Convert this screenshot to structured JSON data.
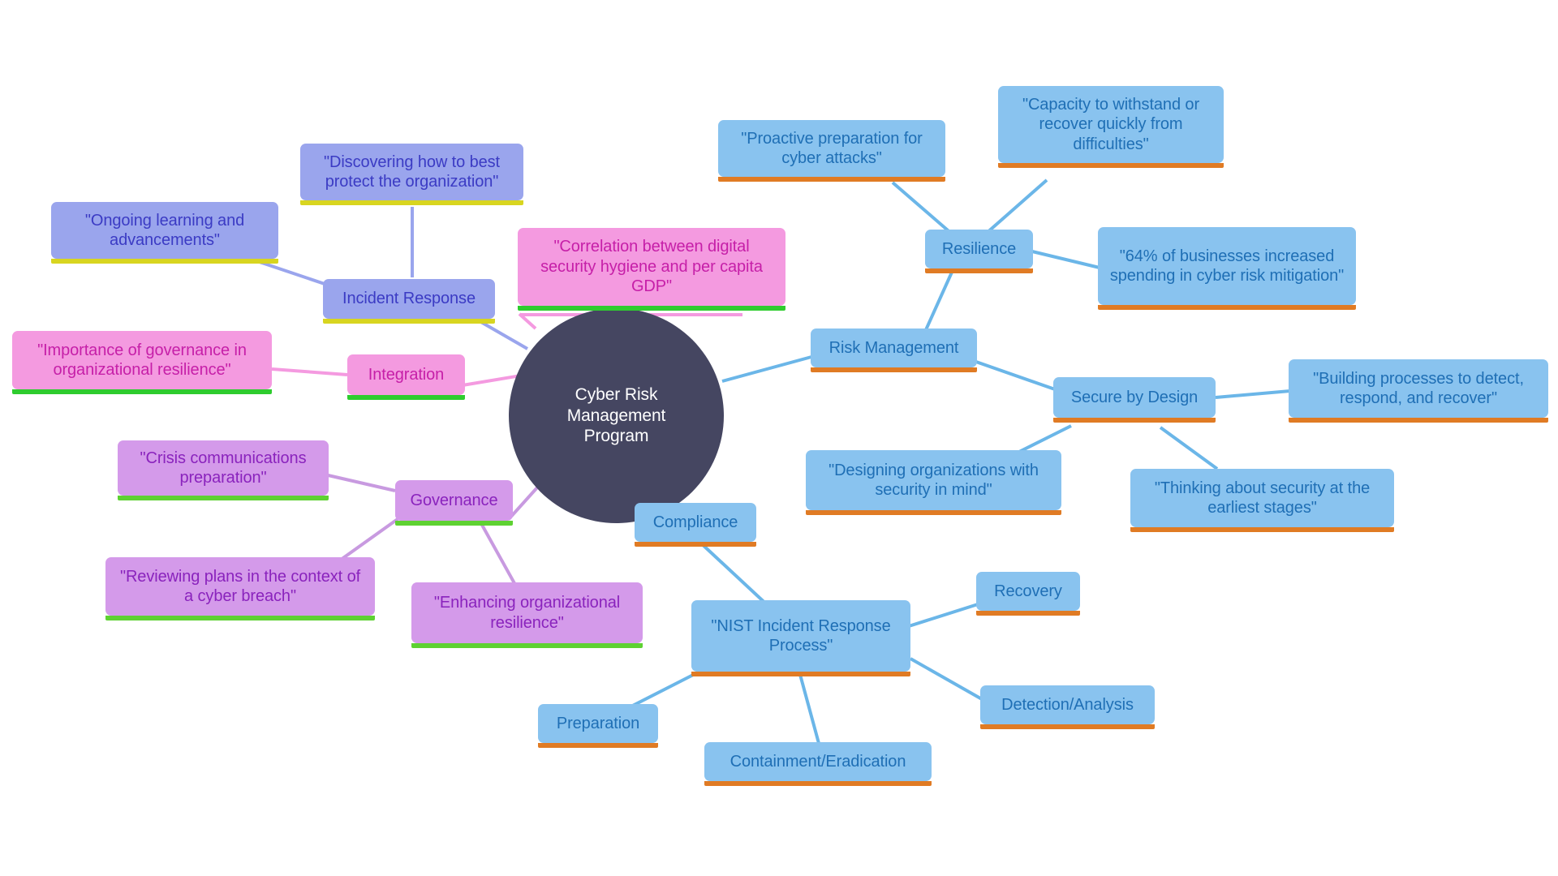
{
  "diagram": {
    "type": "mind-map",
    "title": "Cyber Risk Management Program",
    "background": "#ffffff",
    "root": {
      "id": "root",
      "label": "Cyber Risk Management Program",
      "shape": "circle",
      "fill": "#454661",
      "text_color": "#ffffff"
    },
    "branch_styles": {
      "blue": {
        "fill": "#89c3ef",
        "text_color": "#1f6fb5",
        "accent": "#e07b24",
        "edge": "#6bb6e8"
      },
      "periwinkle": {
        "fill": "#9aa5ed",
        "text_color": "#3b3bc4",
        "accent": "#d8d520",
        "edge": "#9aa5ed"
      },
      "pink": {
        "fill": "#f49ae0",
        "text_color": "#c61fa8",
        "accent": "#2ecc2e",
        "edge": "#f49ae0"
      },
      "orchid": {
        "fill": "#d49aea",
        "text_color": "#8a23bd",
        "accent": "#5ed132",
        "edge": "#c89ae0"
      }
    },
    "nodes": [
      {
        "id": "risk_management",
        "label": "Risk Management",
        "branch": "blue"
      },
      {
        "id": "resilience",
        "label": "Resilience",
        "branch": "blue"
      },
      {
        "id": "proactive_prep",
        "label": "\"Proactive preparation for cyber attacks\"",
        "branch": "blue"
      },
      {
        "id": "capacity_withstand",
        "label": "\"Capacity to withstand or recover quickly from difficulties\"",
        "branch": "blue"
      },
      {
        "id": "spending_stat",
        "label": "\"64% of businesses increased spending in cyber risk mitigation\"",
        "branch": "blue"
      },
      {
        "id": "secure_by_design",
        "label": "Secure by Design",
        "branch": "blue"
      },
      {
        "id": "building_processes",
        "label": "\"Building processes to detect, respond, and recover\"",
        "branch": "blue"
      },
      {
        "id": "designing_orgs",
        "label": "\"Designing organizations with security in mind\"",
        "branch": "blue"
      },
      {
        "id": "thinking_earliest",
        "label": "\"Thinking about security at the earliest stages\"",
        "branch": "blue"
      },
      {
        "id": "compliance",
        "label": "Compliance",
        "branch": "blue"
      },
      {
        "id": "nist_process",
        "label": "\"NIST Incident Response Process\"",
        "branch": "blue"
      },
      {
        "id": "recovery",
        "label": "Recovery",
        "branch": "blue"
      },
      {
        "id": "detection_analysis",
        "label": "Detection/Analysis",
        "branch": "blue"
      },
      {
        "id": "preparation",
        "label": "Preparation",
        "branch": "blue"
      },
      {
        "id": "containment",
        "label": "Containment/Eradication",
        "branch": "blue"
      },
      {
        "id": "incident_response",
        "label": "Incident Response",
        "branch": "periwinkle"
      },
      {
        "id": "ongoing_learning",
        "label": "\"Ongoing learning and advancements\"",
        "branch": "periwinkle"
      },
      {
        "id": "discovering_protect",
        "label": "\"Discovering how to best protect the organization\"",
        "branch": "periwinkle"
      },
      {
        "id": "integration",
        "label": "Integration",
        "branch": "pink"
      },
      {
        "id": "correlation_gdp",
        "label": "\"Correlation between digital security hygiene and per capita GDP\"",
        "branch": "pink"
      },
      {
        "id": "governance_importance",
        "label": "\"Importance of governance in organizational resilience\"",
        "branch": "pink"
      },
      {
        "id": "governance",
        "label": "Governance",
        "branch": "orchid"
      },
      {
        "id": "crisis_comms",
        "label": "\"Crisis communications preparation\"",
        "branch": "orchid"
      },
      {
        "id": "reviewing_plans",
        "label": "\"Reviewing plans in the context of a cyber breach\"",
        "branch": "orchid"
      },
      {
        "id": "enhancing_resilience",
        "label": "\"Enhancing organizational resilience\"",
        "branch": "orchid"
      }
    ],
    "edges": [
      {
        "from": "root",
        "to": "risk_management",
        "color": "#6bb6e8"
      },
      {
        "from": "root",
        "to": "compliance",
        "color": "#6bb6e8"
      },
      {
        "from": "root",
        "to": "incident_response",
        "color": "#9aa5ed"
      },
      {
        "from": "root",
        "to": "correlation_gdp",
        "color": "#f49ae0"
      },
      {
        "from": "root",
        "to": "integration",
        "color": "#f49ae0"
      },
      {
        "from": "root",
        "to": "governance",
        "color": "#c89ae0"
      },
      {
        "from": "risk_management",
        "to": "resilience",
        "color": "#6bb6e8"
      },
      {
        "from": "risk_management",
        "to": "secure_by_design",
        "color": "#6bb6e8"
      },
      {
        "from": "resilience",
        "to": "proactive_prep",
        "color": "#6bb6e8"
      },
      {
        "from": "resilience",
        "to": "capacity_withstand",
        "color": "#6bb6e8"
      },
      {
        "from": "resilience",
        "to": "spending_stat",
        "color": "#6bb6e8"
      },
      {
        "from": "secure_by_design",
        "to": "building_processes",
        "color": "#6bb6e8"
      },
      {
        "from": "secure_by_design",
        "to": "designing_orgs",
        "color": "#6bb6e8"
      },
      {
        "from": "secure_by_design",
        "to": "thinking_earliest",
        "color": "#6bb6e8"
      },
      {
        "from": "compliance",
        "to": "nist_process",
        "color": "#6bb6e8"
      },
      {
        "from": "nist_process",
        "to": "recovery",
        "color": "#6bb6e8"
      },
      {
        "from": "nist_process",
        "to": "detection_analysis",
        "color": "#6bb6e8"
      },
      {
        "from": "nist_process",
        "to": "preparation",
        "color": "#6bb6e8"
      },
      {
        "from": "nist_process",
        "to": "containment",
        "color": "#6bb6e8"
      },
      {
        "from": "incident_response",
        "to": "ongoing_learning",
        "color": "#9aa5ed"
      },
      {
        "from": "incident_response",
        "to": "discovering_protect",
        "color": "#9aa5ed"
      },
      {
        "from": "integration",
        "to": "governance_importance",
        "color": "#f49ae0"
      },
      {
        "from": "governance",
        "to": "crisis_comms",
        "color": "#c89ae0"
      },
      {
        "from": "governance",
        "to": "reviewing_plans",
        "color": "#c89ae0"
      },
      {
        "from": "governance",
        "to": "enhancing_resilience",
        "color": "#c89ae0"
      }
    ]
  }
}
